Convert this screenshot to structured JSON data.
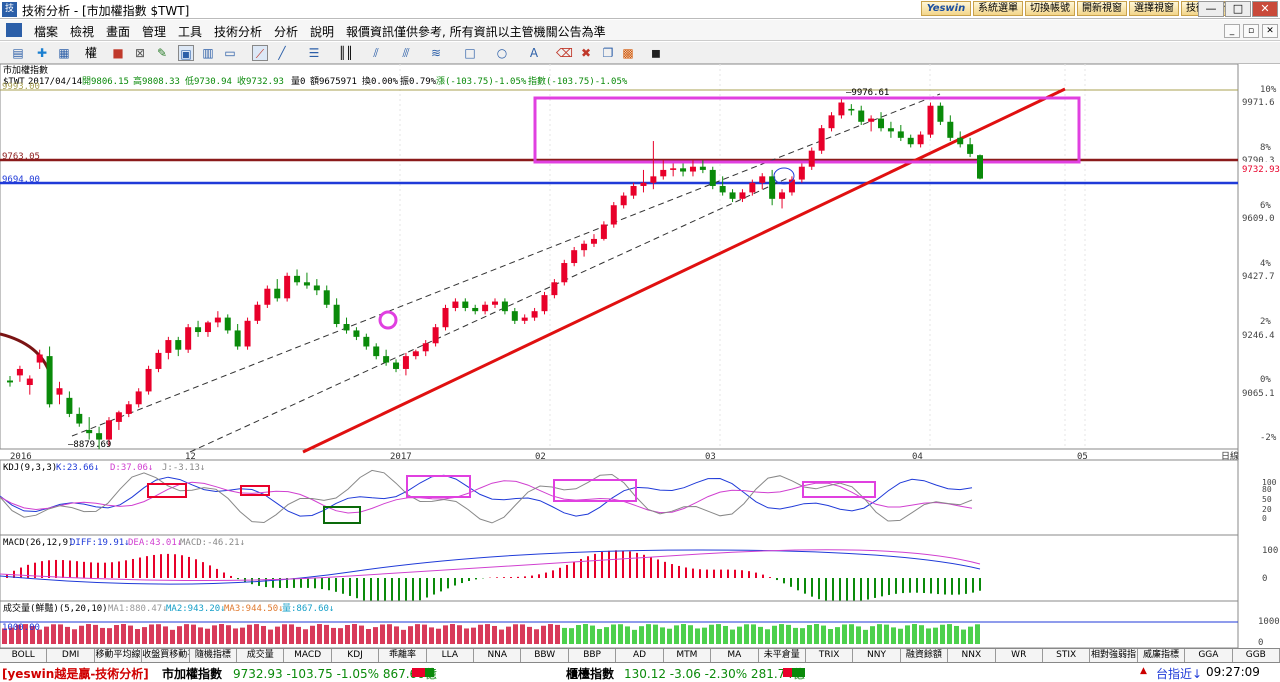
{
  "window": {
    "title": "技術分析 - [市加權指數 $TWT]",
    "app_icon": "技"
  },
  "top_buttons": [
    "Yeswin",
    "系統選單",
    "切換帳號",
    "開新視窗",
    "選擇視窗",
    "技術分析"
  ],
  "window_controls": {
    "minimize": "—",
    "maximize": "□",
    "close": "✕"
  },
  "mdi_controls": {
    "minimize": "_",
    "restore": "▫",
    "close": "✕"
  },
  "menu": [
    "檔案",
    "檢視",
    "畫面",
    "管理",
    "工具",
    "技術分析",
    "分析",
    "說明",
    "報價資訊僅供參考, 所有資訊以主管機關公告為準"
  ],
  "toolbar_icons": [
    "layout-icon",
    "crosshair-icon",
    "grid-icon",
    "weight-icon",
    "color-icon",
    "export-icon",
    "edit-icon",
    "window-icon",
    "chart-icon",
    "pointer-icon",
    "line-icon",
    "hline-icon",
    "vline-icon",
    "fib-icon",
    "channel-icon",
    "gann-icon",
    "rect-icon",
    "ellipse-icon",
    "text-icon",
    "erase-icon",
    "delete-icon",
    "palette-icon",
    "save-icon"
  ],
  "toolbar_weight_label": "權",
  "main_chart": {
    "name": "市加權指數",
    "info": {
      "code": "$TWT",
      "date": "2017/04/14",
      "open": "開9806.15",
      "high": "高9808.33",
      "low": "低9730.94",
      "close": "收9732.93",
      "vol": "量0",
      "amount": "額9675971",
      "turnover": "換0.00%",
      "amplitude": "振0.79%",
      "change": "漲(-103.75)-1.05%",
      "index_chg": "指數(-103.75)-1.05%"
    },
    "hlines": [
      {
        "label": "9993.00",
        "color": "#a8a050"
      },
      {
        "label": "9763.05",
        "color": "#8b1a1a"
      },
      {
        "label": "9694.00",
        "color": "#1f3ad8"
      }
    ],
    "y_ticks_price": [
      "9971.6",
      "9790.3",
      "9609.0",
      "9427.7",
      "9246.4",
      "9065.1"
    ],
    "y_ticks_pct": [
      "10%",
      "8%",
      "6%",
      "4%",
      "2%",
      "0%",
      "-2%"
    ],
    "last_price": "9732.93",
    "high_label": "9976.61",
    "low_label": "8879.69",
    "x_labels": [
      "2016",
      "12",
      "2017",
      "02",
      "03",
      "04",
      "05",
      "日線"
    ]
  },
  "kdj": {
    "label": "KDJ(9,3,3)",
    "k": "K:23.66↓",
    "d": "D:37.06↓",
    "j": "J:-3.13↓",
    "ticks": [
      "100",
      "80",
      "50",
      "20",
      "0"
    ]
  },
  "macd": {
    "label": "MACD(26,12,9)",
    "diff": "DIFF:19.91↓",
    "dea": "DEA:43.01↓",
    "macd": "MACD:-46.21↓",
    "ticks": [
      "100",
      "0"
    ]
  },
  "volume": {
    "label": "成交量(鮮豔)(5,20,10)",
    "ma1": "MA1:880.47↓",
    "ma2": "MA2:943.20↓",
    "ma3": "MA3:944.50↓",
    "vol": "量:867.60↓",
    "line_label": "1000.00",
    "ticks": [
      "1000",
      "0"
    ]
  },
  "tabs": [
    "BOLL",
    "DMI",
    "移動平均線",
    "收盤買移動平",
    "隨機指標",
    "成交量",
    "MACD",
    "KDJ",
    "乖離率",
    "LLA",
    "NNA",
    "BBW",
    "BBP",
    "AD",
    "MTM",
    "MA",
    "未平倉量",
    "TRIX",
    "NNY",
    "融資餘額",
    "NNX",
    "WR",
    "STIX",
    "相對強弱指",
    "威廉指標",
    "GGA",
    "GGB"
  ],
  "status": {
    "brand": "[yeswin越是贏-技術分析]",
    "idx1_name": "市加權指數",
    "idx1_vals": "9732.93 -103.75 -1.05% 867.60億",
    "idx2_name": "櫃檯指數",
    "idx2_vals": "130.12 -3.06 -2.30% 281.74億",
    "right_label": "台指近↓",
    "time": "09:27:09"
  },
  "colors": {
    "up": "#e8002a",
    "down": "#0a8a0a",
    "highlight": "#e040e0",
    "trend": "#e01010",
    "blue_line": "#1f3ad8"
  },
  "candles": [
    {
      "o": 9104,
      "h": 9118,
      "l": 9085,
      "c": 9098
    },
    {
      "o": 9120,
      "h": 9150,
      "l": 9100,
      "c": 9140
    },
    {
      "o": 9090,
      "h": 9120,
      "l": 9060,
      "c": 9110
    },
    {
      "o": 9160,
      "h": 9200,
      "l": 9140,
      "c": 9185
    },
    {
      "o": 9180,
      "h": 9210,
      "l": 9020,
      "c": 9030
    },
    {
      "o": 9060,
      "h": 9100,
      "l": 9030,
      "c": 9080
    },
    {
      "o": 9050,
      "h": 9070,
      "l": 8990,
      "c": 9000
    },
    {
      "o": 9000,
      "h": 9020,
      "l": 8960,
      "c": 8970
    },
    {
      "o": 8950,
      "h": 8990,
      "l": 8920,
      "c": 8940
    },
    {
      "o": 8940,
      "h": 8960,
      "l": 8890,
      "c": 8920
    },
    {
      "o": 8920,
      "h": 8990,
      "l": 8900,
      "c": 8980
    },
    {
      "o": 8975,
      "h": 9010,
      "l": 8950,
      "c": 9005
    },
    {
      "o": 9000,
      "h": 9040,
      "l": 8990,
      "c": 9030
    },
    {
      "o": 9030,
      "h": 9080,
      "l": 9020,
      "c": 9070
    },
    {
      "o": 9070,
      "h": 9150,
      "l": 9060,
      "c": 9140
    },
    {
      "o": 9140,
      "h": 9200,
      "l": 9130,
      "c": 9190
    },
    {
      "o": 9190,
      "h": 9240,
      "l": 9170,
      "c": 9230
    },
    {
      "o": 9230,
      "h": 9240,
      "l": 9180,
      "c": 9200
    },
    {
      "o": 9200,
      "h": 9280,
      "l": 9190,
      "c": 9270
    },
    {
      "o": 9270,
      "h": 9290,
      "l": 9240,
      "c": 9255
    },
    {
      "o": 9255,
      "h": 9290,
      "l": 9240,
      "c": 9285
    },
    {
      "o": 9285,
      "h": 9320,
      "l": 9270,
      "c": 9300
    },
    {
      "o": 9300,
      "h": 9310,
      "l": 9250,
      "c": 9260
    },
    {
      "o": 9260,
      "h": 9280,
      "l": 9200,
      "c": 9210
    },
    {
      "o": 9210,
      "h": 9300,
      "l": 9200,
      "c": 9290
    },
    {
      "o": 9290,
      "h": 9350,
      "l": 9280,
      "c": 9340
    },
    {
      "o": 9340,
      "h": 9400,
      "l": 9330,
      "c": 9390
    },
    {
      "o": 9390,
      "h": 9420,
      "l": 9350,
      "c": 9360
    },
    {
      "o": 9360,
      "h": 9440,
      "l": 9350,
      "c": 9430
    },
    {
      "o": 9430,
      "h": 9450,
      "l": 9400,
      "c": 9410
    },
    {
      "o": 9410,
      "h": 9440,
      "l": 9390,
      "c": 9400
    },
    {
      "o": 9400,
      "h": 9420,
      "l": 9370,
      "c": 9385
    },
    {
      "o": 9385,
      "h": 9400,
      "l": 9330,
      "c": 9340
    },
    {
      "o": 9340,
      "h": 9360,
      "l": 9270,
      "c": 9280
    },
    {
      "o": 9280,
      "h": 9300,
      "l": 9250,
      "c": 9260
    },
    {
      "o": 9260,
      "h": 9270,
      "l": 9230,
      "c": 9240
    },
    {
      "o": 9240,
      "h": 9250,
      "l": 9200,
      "c": 9210
    },
    {
      "o": 9210,
      "h": 9220,
      "l": 9170,
      "c": 9180
    },
    {
      "o": 9180,
      "h": 9200,
      "l": 9150,
      "c": 9160
    },
    {
      "o": 9160,
      "h": 9170,
      "l": 9130,
      "c": 9140
    },
    {
      "o": 9140,
      "h": 9190,
      "l": 9120,
      "c": 9180
    },
    {
      "o": 9180,
      "h": 9200,
      "l": 9170,
      "c": 9195
    },
    {
      "o": 9195,
      "h": 9230,
      "l": 9180,
      "c": 9220
    },
    {
      "o": 9220,
      "h": 9280,
      "l": 9210,
      "c": 9270
    },
    {
      "o": 9270,
      "h": 9340,
      "l": 9260,
      "c": 9330
    },
    {
      "o": 9330,
      "h": 9360,
      "l": 9320,
      "c": 9350
    },
    {
      "o": 9350,
      "h": 9360,
      "l": 9320,
      "c": 9330
    },
    {
      "o": 9330,
      "h": 9340,
      "l": 9310,
      "c": 9320
    },
    {
      "o": 9320,
      "h": 9350,
      "l": 9310,
      "c": 9340
    },
    {
      "o": 9340,
      "h": 9360,
      "l": 9330,
      "c": 9350
    },
    {
      "o": 9350,
      "h": 9360,
      "l": 9310,
      "c": 9320
    },
    {
      "o": 9320,
      "h": 9330,
      "l": 9280,
      "c": 9290
    },
    {
      "o": 9290,
      "h": 9310,
      "l": 9280,
      "c": 9300
    },
    {
      "o": 9300,
      "h": 9330,
      "l": 9290,
      "c": 9320
    },
    {
      "o": 9320,
      "h": 9380,
      "l": 9310,
      "c": 9370
    },
    {
      "o": 9370,
      "h": 9420,
      "l": 9360,
      "c": 9410
    },
    {
      "o": 9410,
      "h": 9480,
      "l": 9400,
      "c": 9470
    },
    {
      "o": 9470,
      "h": 9520,
      "l": 9460,
      "c": 9510
    },
    {
      "o": 9510,
      "h": 9540,
      "l": 9490,
      "c": 9530
    },
    {
      "o": 9530,
      "h": 9560,
      "l": 9520,
      "c": 9545
    },
    {
      "o": 9545,
      "h": 9600,
      "l": 9540,
      "c": 9590
    },
    {
      "o": 9590,
      "h": 9660,
      "l": 9580,
      "c": 9650
    },
    {
      "o": 9650,
      "h": 9690,
      "l": 9640,
      "c": 9680
    },
    {
      "o": 9680,
      "h": 9720,
      "l": 9670,
      "c": 9710
    },
    {
      "o": 9710,
      "h": 9760,
      "l": 9690,
      "c": 9720
    },
    {
      "o": 9720,
      "h": 9850,
      "l": 9700,
      "c": 9740
    },
    {
      "o": 9740,
      "h": 9790,
      "l": 9730,
      "c": 9760
    },
    {
      "o": 9760,
      "h": 9780,
      "l": 9740,
      "c": 9765
    },
    {
      "o": 9765,
      "h": 9780,
      "l": 9740,
      "c": 9755
    },
    {
      "o": 9755,
      "h": 9790,
      "l": 9740,
      "c": 9770
    },
    {
      "o": 9770,
      "h": 9790,
      "l": 9750,
      "c": 9760
    },
    {
      "o": 9760,
      "h": 9770,
      "l": 9700,
      "c": 9710
    },
    {
      "o": 9710,
      "h": 9740,
      "l": 9680,
      "c": 9690
    },
    {
      "o": 9690,
      "h": 9700,
      "l": 9660,
      "c": 9670
    },
    {
      "o": 9670,
      "h": 9700,
      "l": 9660,
      "c": 9690
    },
    {
      "o": 9690,
      "h": 9730,
      "l": 9680,
      "c": 9720
    },
    {
      "o": 9720,
      "h": 9750,
      "l": 9700,
      "c": 9740
    },
    {
      "o": 9740,
      "h": 9760,
      "l": 9650,
      "c": 9670
    },
    {
      "o": 9670,
      "h": 9700,
      "l": 9640,
      "c": 9690
    },
    {
      "o": 9690,
      "h": 9740,
      "l": 9680,
      "c": 9730
    },
    {
      "o": 9730,
      "h": 9780,
      "l": 9720,
      "c": 9770
    },
    {
      "o": 9770,
      "h": 9830,
      "l": 9760,
      "c": 9820
    },
    {
      "o": 9820,
      "h": 9900,
      "l": 9810,
      "c": 9890
    },
    {
      "o": 9890,
      "h": 9940,
      "l": 9880,
      "c": 9930
    },
    {
      "o": 9930,
      "h": 9980,
      "l": 9920,
      "c": 9970
    },
    {
      "o": 9950,
      "h": 9965,
      "l": 9930,
      "c": 9945
    },
    {
      "o": 9945,
      "h": 9960,
      "l": 9900,
      "c": 9910
    },
    {
      "o": 9910,
      "h": 9930,
      "l": 9880,
      "c": 9920
    },
    {
      "o": 9920,
      "h": 9940,
      "l": 9880,
      "c": 9890
    },
    {
      "o": 9890,
      "h": 9910,
      "l": 9860,
      "c": 9880
    },
    {
      "o": 9880,
      "h": 9900,
      "l": 9850,
      "c": 9860
    },
    {
      "o": 9860,
      "h": 9870,
      "l": 9830,
      "c": 9840
    },
    {
      "o": 9840,
      "h": 9880,
      "l": 9830,
      "c": 9870
    },
    {
      "o": 9870,
      "h": 9970,
      "l": 9860,
      "c": 9960
    },
    {
      "o": 9960,
      "h": 9970,
      "l": 9900,
      "c": 9910
    },
    {
      "o": 9910,
      "h": 9930,
      "l": 9850,
      "c": 9860
    },
    {
      "o": 9860,
      "h": 9880,
      "l": 9830,
      "c": 9840
    },
    {
      "o": 9840,
      "h": 9860,
      "l": 9800,
      "c": 9810
    },
    {
      "o": 9806,
      "h": 9808,
      "l": 9731,
      "c": 9733
    }
  ]
}
